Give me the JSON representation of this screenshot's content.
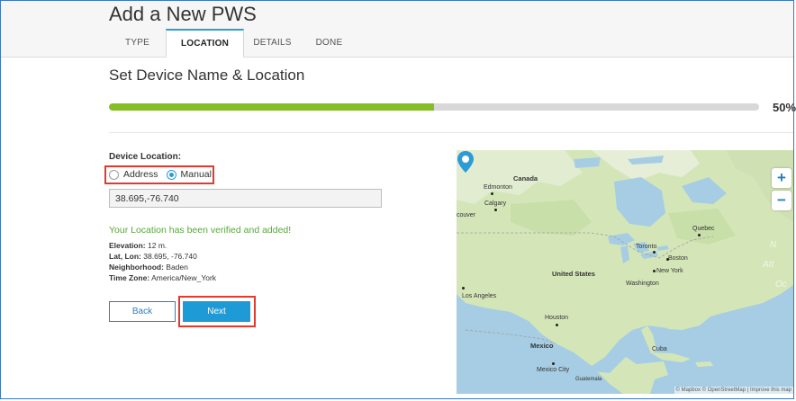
{
  "header": {
    "title": "Add a New PWS",
    "tabs": [
      {
        "label": "TYPE",
        "active": false
      },
      {
        "label": "LOCATION",
        "active": true
      },
      {
        "label": "DETAILS",
        "active": false
      },
      {
        "label": "DONE",
        "active": false
      }
    ]
  },
  "section": {
    "title": "Set Device Name & Location"
  },
  "progress": {
    "value": 0.5,
    "label": "50%"
  },
  "device_location": {
    "label": "Device Location:",
    "options": [
      {
        "label": "Address",
        "checked": false
      },
      {
        "label": "Manual",
        "checked": true
      }
    ],
    "coordinates_value": "38.695,-76.740",
    "verified_message": "Your Location has been verified and added!",
    "details": [
      {
        "key": "Elevation:",
        "value": "12 m."
      },
      {
        "key": "Lat, Lon:",
        "value": "38.695, -76.740"
      },
      {
        "key": "Neighborhood:",
        "value": "Baden"
      },
      {
        "key": "Time Zone:",
        "value": "America/New_York"
      }
    ]
  },
  "buttons": {
    "back": "Back",
    "next": "Next"
  },
  "map": {
    "zoom_in": "+",
    "zoom_out": "−",
    "labels": {
      "canada": "Canada",
      "edmonton": "Edmonton",
      "calgary": "Calgary",
      "couver": "couver",
      "quebec": "Quebec",
      "toronto": "Toronto",
      "boston": "Boston",
      "new_york": "New York",
      "washington": "Washington",
      "united_states": "United States",
      "los_angeles": "Los Angeles",
      "houston": "Houston",
      "mexico": "Mexico",
      "cuba": "Cuba",
      "mexico_city": "Mexico City",
      "guatemala": "Guatemala"
    },
    "ghost": [
      "N",
      "Att",
      "Oc"
    ],
    "attribution": "© Mapbox © OpenStreetMap | Improve this map"
  },
  "colors": {
    "accent": "#1e9ad6",
    "progress": "#84bd24",
    "verified": "#58a83a",
    "highlight": "#e33a2e",
    "marker": "#2c9bd6"
  }
}
